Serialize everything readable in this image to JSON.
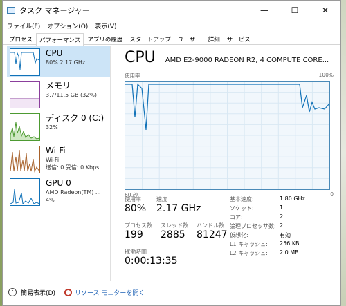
{
  "window": {
    "title": "タスク マネージャー",
    "controls": {
      "minimize": "—",
      "maximize": "☐",
      "close": "✕"
    }
  },
  "menu": [
    "ファイル(F)",
    "オプション(O)",
    "表示(V)"
  ],
  "tabs": [
    "プロセス",
    "パフォーマンス",
    "アプリの履歴",
    "スタートアップ",
    "ユーザー",
    "詳細",
    "サービス"
  ],
  "active_tab": "パフォーマンス",
  "sidebar": [
    {
      "title": "CPU",
      "sub1": "80%  2.17 GHz",
      "sub2": "",
      "color": "#1172b8"
    },
    {
      "title": "メモリ",
      "sub1": "3.7/11.5 GB (32%)",
      "sub2": "",
      "color": "#8b3f9c"
    },
    {
      "title": "ディスク 0 (C:)",
      "sub1": "32%",
      "sub2": "",
      "color": "#4d9a32"
    },
    {
      "title": "Wi-Fi",
      "sub1": "Wi-Fi",
      "sub2": "送信: 0 受信: 0 Kbps",
      "color": "#a7612a"
    },
    {
      "title": "GPU 0",
      "sub1": "AMD Radeon(TM) ...",
      "sub2": "4%",
      "color": "#1172b8"
    }
  ],
  "main": {
    "title": "CPU",
    "model": "AMD E2-9000 RADEON R2, 4 COMPUTE CORE...",
    "graph_label_left": "使用率",
    "graph_label_right": "100%",
    "graph_time": "60 秒",
    "graph_zero": "0"
  },
  "stats": {
    "usage_label": "使用率",
    "usage": "80%",
    "speed_label": "速度",
    "speed": "2.17 GHz",
    "processes_label": "プロセス数",
    "processes": "199",
    "threads_label": "スレッド数",
    "threads": "2885",
    "handles_label": "ハンドル数",
    "handles": "81247",
    "uptime_label": "稼働時間",
    "uptime": "0:00:13:35"
  },
  "specs": [
    {
      "k": "基本速度:",
      "v": "1.80 GHz"
    },
    {
      "k": "ソケット:",
      "v": "1"
    },
    {
      "k": "コア:",
      "v": "2"
    },
    {
      "k": "論理プロセッサ数:",
      "v": "2"
    },
    {
      "k": "仮想化:",
      "v": "有効"
    },
    {
      "k": "L1 キャッシュ:",
      "v": "256 KB"
    },
    {
      "k": "L2 キャッシュ:",
      "v": "2.0 MB"
    }
  ],
  "footer": {
    "simple": "簡易表示(D)",
    "resmon": "リソース モニターを開く"
  }
}
